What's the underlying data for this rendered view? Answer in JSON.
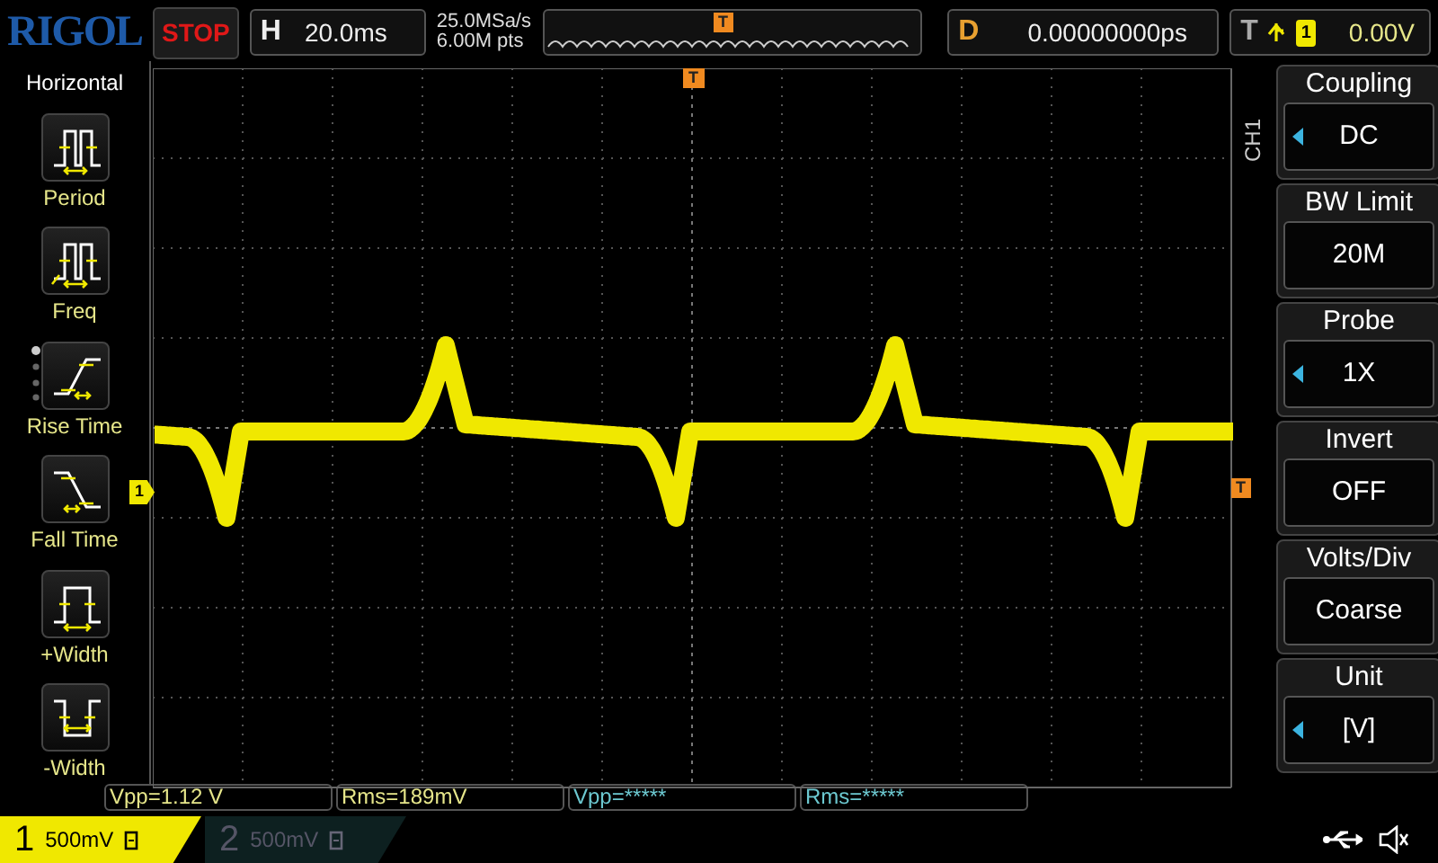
{
  "brand": "RIGOL",
  "run_state": "STOP",
  "timebase": {
    "label": "H",
    "value": "20.0ms"
  },
  "acquisition": {
    "sample_rate": "25.0MSa/s",
    "memory_depth": "6.00M pts",
    "trigger_marker": "T"
  },
  "delay": {
    "label": "D",
    "value": "0.00000000ps"
  },
  "trigger": {
    "label": "T",
    "source": "1",
    "level": "0.00V"
  },
  "left_menu": {
    "title": "Horizontal",
    "items": [
      {
        "label": "Period",
        "kind": "period"
      },
      {
        "label": "Freq",
        "kind": "freq"
      },
      {
        "label": "Rise Time",
        "kind": "rise"
      },
      {
        "label": "Fall Time",
        "kind": "fall"
      },
      {
        "label": "+Width",
        "kind": "pwidth"
      },
      {
        "label": "-Width",
        "kind": "nwidth"
      }
    ]
  },
  "scope": {
    "channel_marker": "1",
    "trigger_position_marker": "T",
    "trigger_level_marker": "T"
  },
  "right_menu": {
    "channel": "CH1",
    "items": [
      {
        "title": "Coupling",
        "value": "DC",
        "adjustable": true
      },
      {
        "title": "BW Limit",
        "value": "20M",
        "adjustable": false
      },
      {
        "title": "Probe",
        "value": "1X",
        "adjustable": true
      },
      {
        "title": "Invert",
        "value": "OFF",
        "adjustable": false
      },
      {
        "title": "Volts/Div",
        "value": "Coarse",
        "adjustable": false
      },
      {
        "title": "Unit",
        "value": "[V]",
        "adjustable": true
      }
    ]
  },
  "measurements": [
    {
      "text": "Vpp=1.12 V",
      "color": "#e6e68a"
    },
    {
      "text": "Rms=189mV",
      "color": "#e6e68a"
    },
    {
      "text": "Vpp=*****",
      "color": "#6cc8d0"
    },
    {
      "text": "Rms=*****",
      "color": "#6cc8d0"
    }
  ],
  "channels": [
    {
      "number": "1",
      "scale": "500mV",
      "on": true
    },
    {
      "number": "2",
      "scale": "500mV",
      "on": false
    }
  ]
}
